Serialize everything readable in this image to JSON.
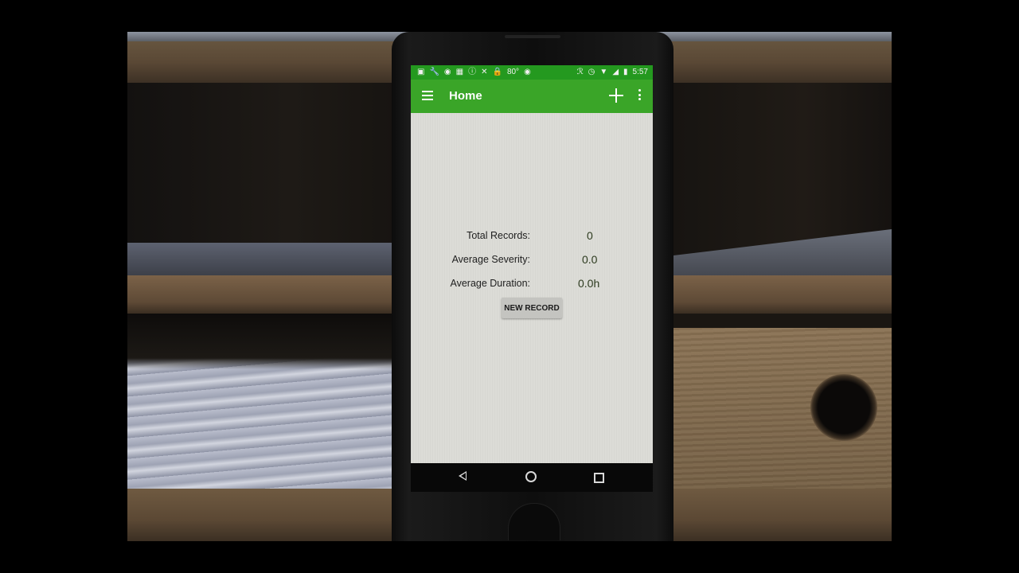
{
  "status_bar": {
    "left_icons": [
      "notification-icon",
      "wrench-icon",
      "fire-icon",
      "facebook-icon",
      "info-icon",
      "no-signal-icon",
      "lock-icon",
      "temperature",
      "android-icon"
    ],
    "temperature": "80°",
    "right_icons": [
      "bluetooth-icon",
      "alarm-icon",
      "wifi-icon",
      "signal-icon",
      "battery-icon"
    ],
    "time": "5:57"
  },
  "toolbar": {
    "title": "Home",
    "menu_icon": "hamburger-menu-icon",
    "add_icon": "plus-icon",
    "overflow_icon": "more-vert-icon"
  },
  "stats": [
    {
      "label": "Total Records:",
      "value": "0"
    },
    {
      "label": "Average Severity:",
      "value": "0.0"
    },
    {
      "label": "Average Duration:",
      "value": "0.0h"
    }
  ],
  "new_record_button": {
    "label": "NEW RECORD"
  },
  "colors": {
    "status_bar": "#24991f",
    "toolbar": "#3aa528",
    "content_background": "#dcdcd7"
  }
}
